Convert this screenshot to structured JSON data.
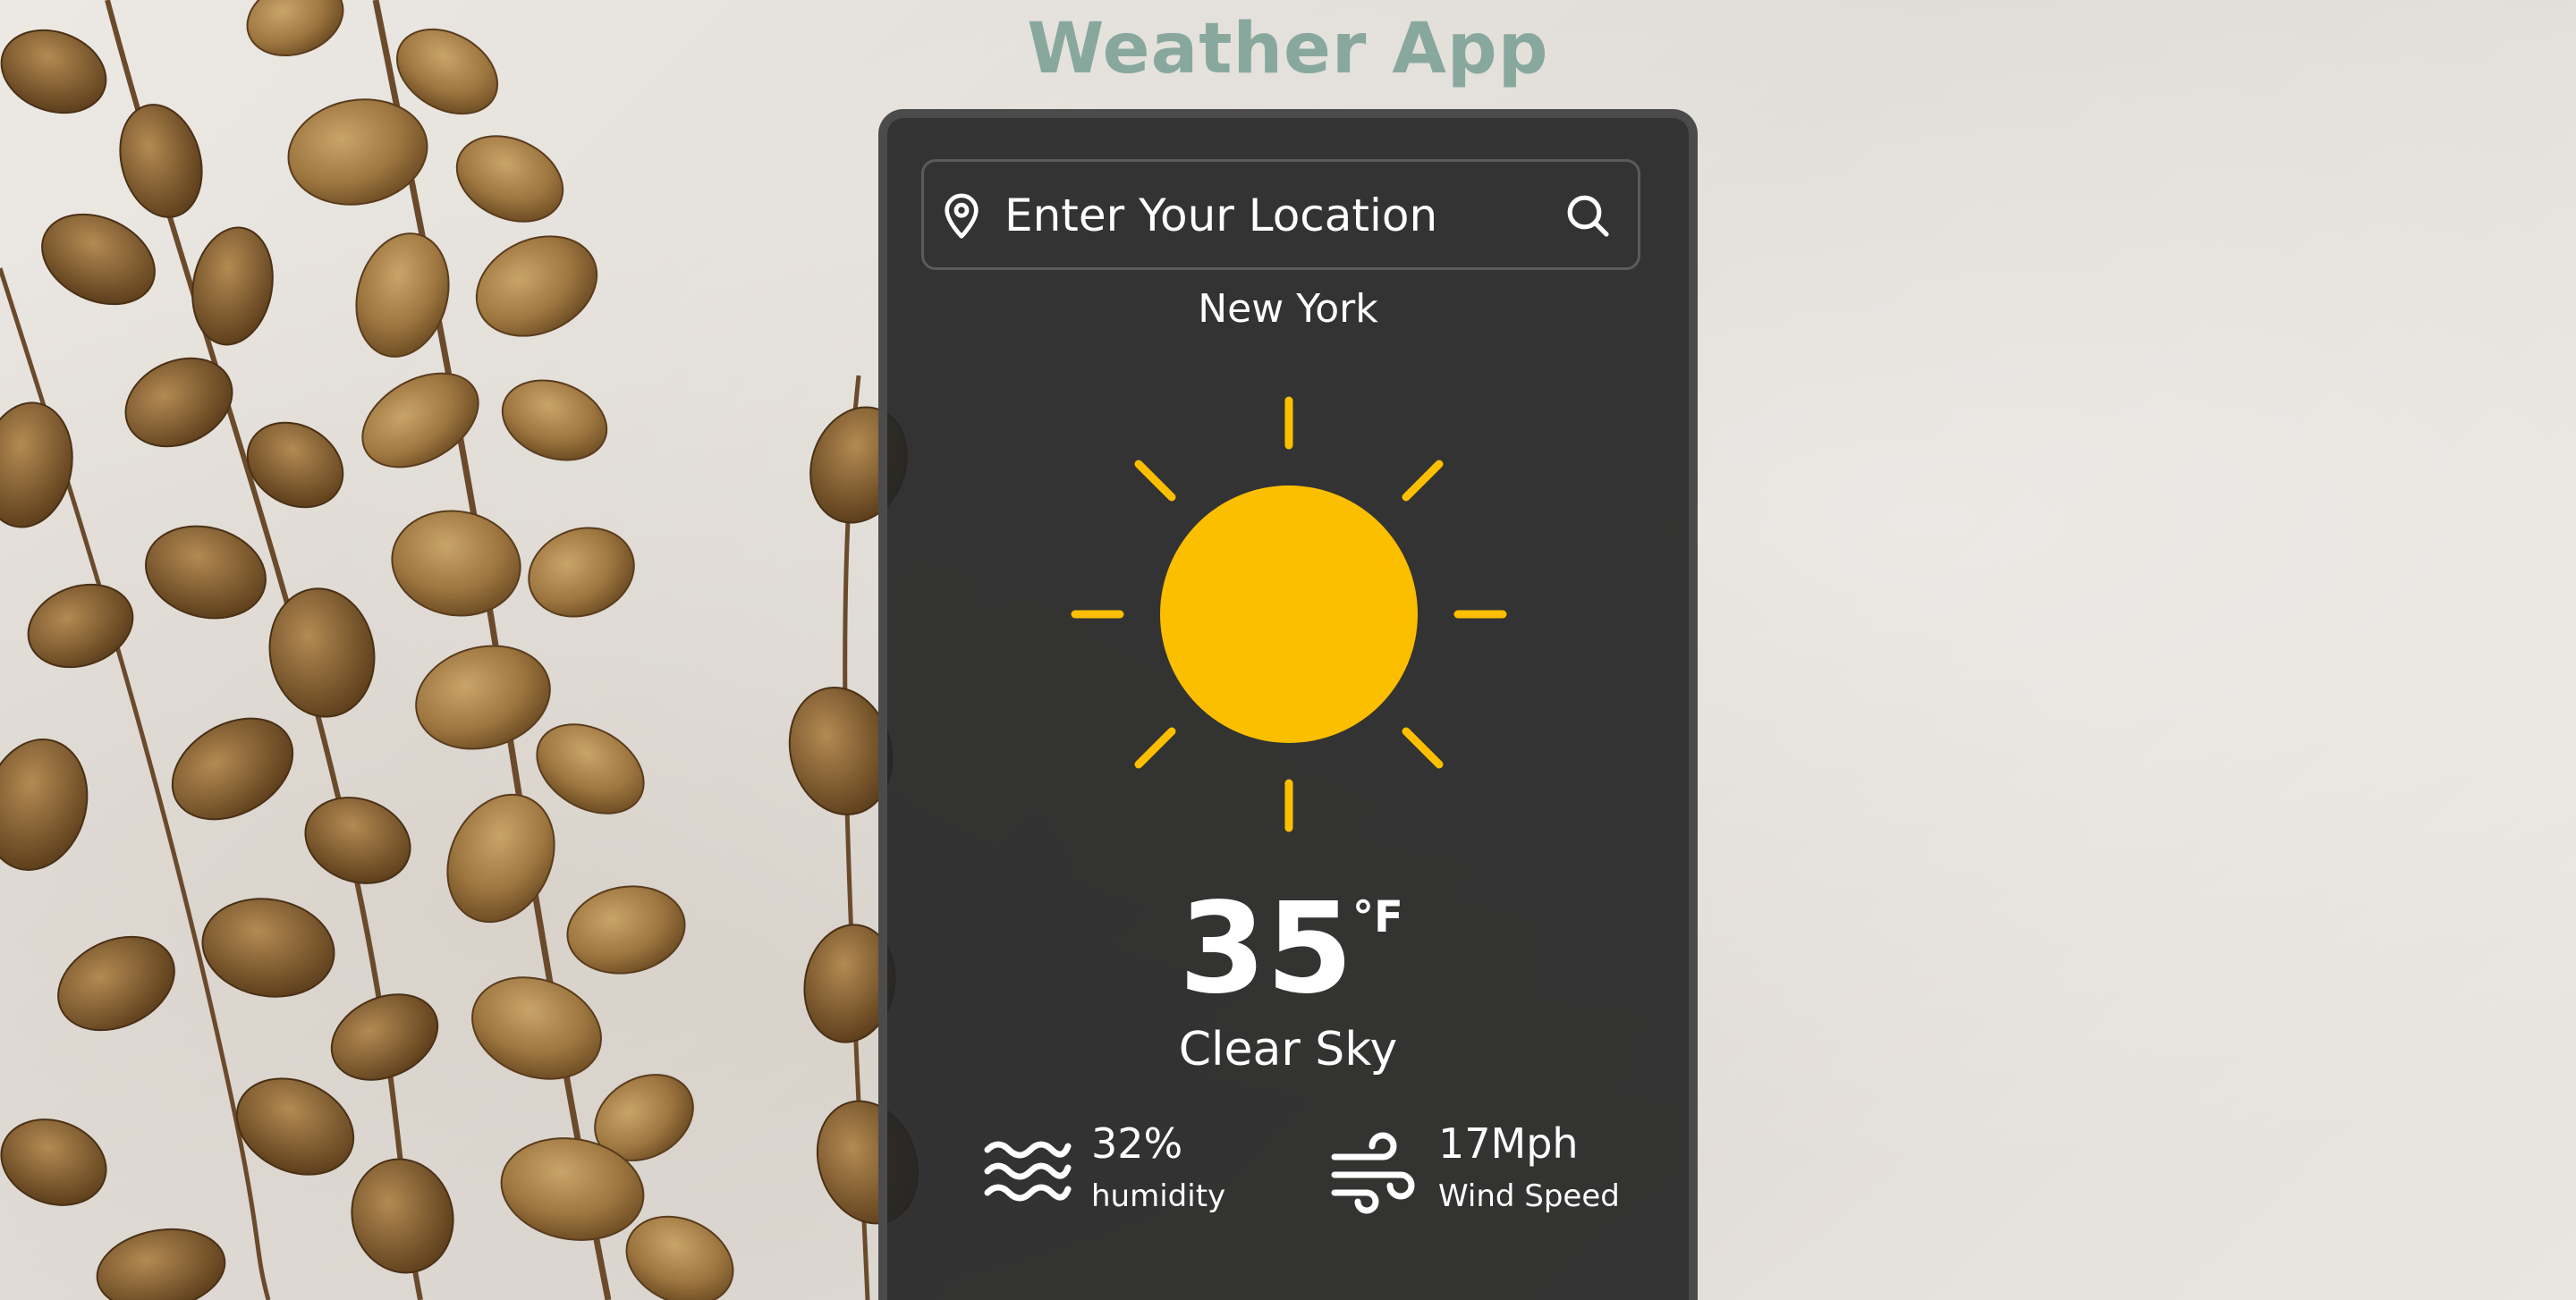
{
  "app": {
    "title": "Weather App"
  },
  "search": {
    "placeholder": "Enter Your Location",
    "location_icon": "location-pin-icon",
    "search_icon": "search-icon"
  },
  "weather": {
    "city": "New York",
    "icon": "sun-icon",
    "temperature": "35",
    "unit": "°F",
    "description": "Clear Sky"
  },
  "stats": {
    "humidity": {
      "icon": "waves-icon",
      "value": "32%",
      "label": "humidity"
    },
    "wind": {
      "icon": "wind-icon",
      "value": "17Mph",
      "label": "Wind Speed"
    }
  },
  "colors": {
    "title": "#88a89e",
    "card_bg": "#262626",
    "card_border": "#4b4b4b",
    "sun": "#fbbf00",
    "text": "#ffffff"
  }
}
